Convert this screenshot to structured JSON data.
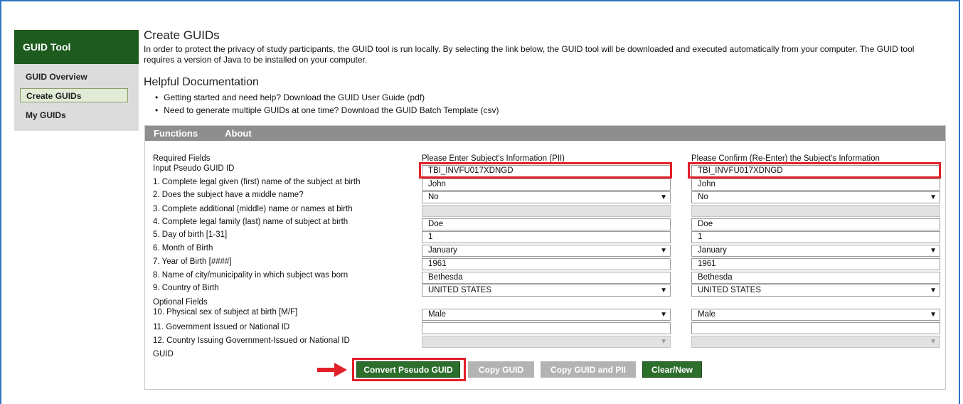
{
  "sidebar": {
    "title": "GUID Tool",
    "items": [
      "GUID Overview",
      "Create GUIDs",
      "My GUIDs"
    ],
    "active": "Create GUIDs"
  },
  "header": {
    "title": "Create GUIDs",
    "intro": "In order to protect the privacy of study participants, the GUID tool is run locally. By selecting the link below, the GUID tool will be downloaded and executed automatically from your computer. The GUID tool requires a version of Java to be installed on your computer.",
    "doc_title": "Helpful Documentation",
    "docs": [
      "Getting started and need help? Download the GUID User Guide (pdf)",
      "Need to generate multiple GUIDs at one time? Download the GUID Batch Template (csv)"
    ]
  },
  "tabs": [
    "Functions",
    "About"
  ],
  "form": {
    "required_label": "Required Fields",
    "col1_header": "Please Enter Subject's Information (PII)",
    "col2_header": "Please Confirm (Re-Enter) the Subject's Information",
    "optional_label": "Optional Fields",
    "guid_label": "GUID",
    "fields": [
      {
        "label": "Input Pseudo GUID ID",
        "v1": "TBI_INVFU017XDNGD",
        "v2": "TBI_INVFU017XDNGD"
      },
      {
        "label": "1.  Complete legal given (first) name of the subject at birth",
        "v1": "John",
        "v2": "John"
      },
      {
        "label": "2.  Does the subject have a middle name?",
        "v1": "No",
        "v2": "No"
      },
      {
        "label": "3.  Complete additional (middle) name or names at birth",
        "v1": "",
        "v2": ""
      },
      {
        "label": "4.  Complete legal family (last) name of subject at birth",
        "v1": "Doe",
        "v2": "Doe"
      },
      {
        "label": "5.  Day of birth [1-31]",
        "v1": "1",
        "v2": "1"
      },
      {
        "label": "6.  Month of Birth",
        "v1": "January",
        "v2": "January"
      },
      {
        "label": "7.  Year of Birth [####]",
        "v1": "1961",
        "v2": "1961"
      },
      {
        "label": "8.  Name of city/municipality in which subject was born",
        "v1": "Bethesda",
        "v2": "Bethesda"
      },
      {
        "label": "9.  Country of Birth",
        "v1": "UNITED STATES",
        "v2": "UNITED STATES"
      },
      {
        "label": "10. Physical sex of subject at birth [M/F]",
        "v1": "Male",
        "v2": "Male"
      },
      {
        "label": "11. Government Issued or National ID",
        "v1": "",
        "v2": ""
      },
      {
        "label": "12. Country Issuing Government-Issued or National ID",
        "v1": "",
        "v2": ""
      }
    ]
  },
  "buttons": {
    "convert": "Convert Pseudo GUID",
    "copy_guid": "Copy GUID",
    "copy_guid_pii": "Copy GUID and PII",
    "clear": "Clear/New"
  },
  "colors": {
    "brand_green": "#1e5b1e",
    "button_green": "#2c6e2c",
    "highlight_red": "#e2202a",
    "disabled_grey": "#b3b3b3"
  },
  "icons": {
    "dropdown": "caret-down-icon",
    "pointer": "red-arrow-icon"
  }
}
